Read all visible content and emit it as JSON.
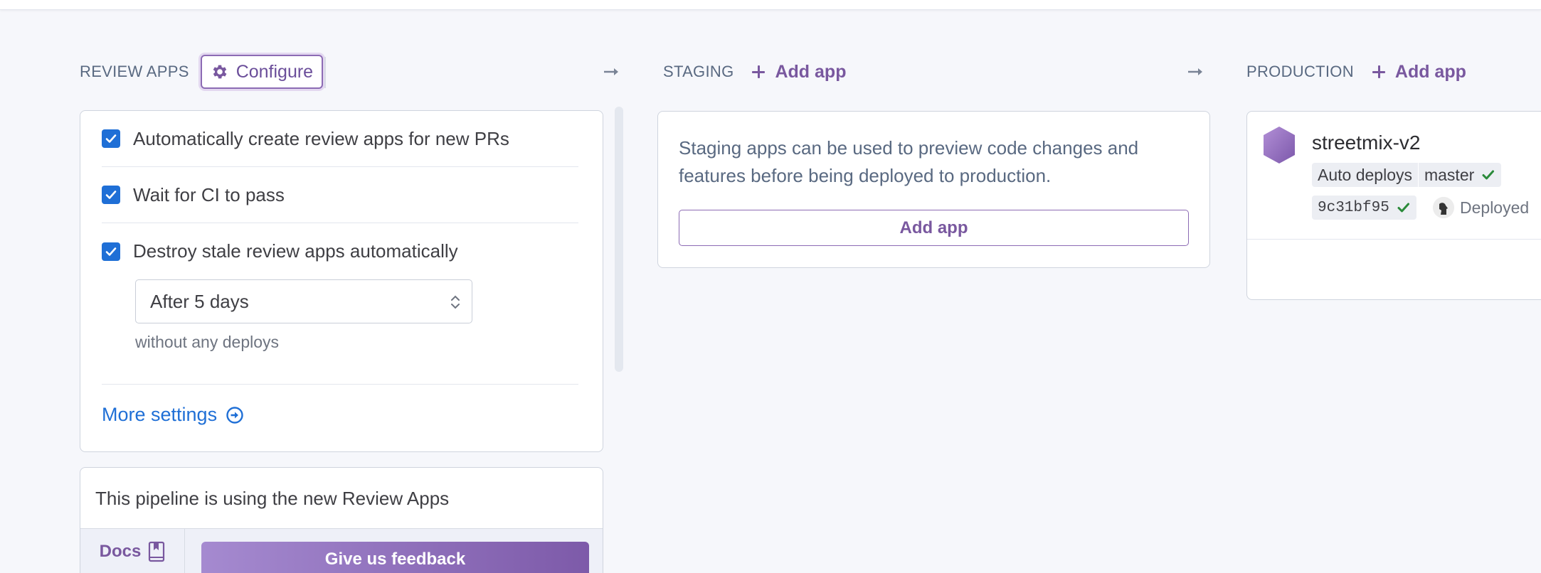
{
  "review_apps": {
    "label": "REVIEW APPS",
    "configure_label": "Configure",
    "options": [
      {
        "label": "Automatically create review apps for new PRs",
        "checked": true
      },
      {
        "label": "Wait for CI to pass",
        "checked": true
      },
      {
        "label": "Destroy stale review apps automatically",
        "checked": true
      }
    ],
    "stale_select": "After 5 days",
    "stale_hint": "without any deploys",
    "more_settings": "More settings",
    "promo_text": "This pipeline is using the new Review Apps",
    "docs_label": "Docs",
    "feedback_label": "Give us feedback"
  },
  "staging": {
    "label": "STAGING",
    "add_app_link": "Add app",
    "description": "Staging apps can be used to preview code changes and features before being deployed to production.",
    "add_app_button": "Add app"
  },
  "production": {
    "label": "PRODUCTION",
    "add_app_link": "Add app",
    "app": {
      "name": "streetmix-v2",
      "auto_deploys": "Auto deploys",
      "branch": "master",
      "commit": "9c31bf95",
      "status": "Deployed"
    }
  },
  "colors": {
    "accent_purple": "#79589f",
    "link_blue": "#1f6fd6",
    "success_green": "#2a8a3a"
  },
  "icons": [
    "gear-icon",
    "plus-icon",
    "arrow-right-icon",
    "checkmark-icon",
    "select-chevrons-icon",
    "circle-arrow-right-icon",
    "book-icon",
    "app-hexagon-icon",
    "user-avatar-icon"
  ]
}
